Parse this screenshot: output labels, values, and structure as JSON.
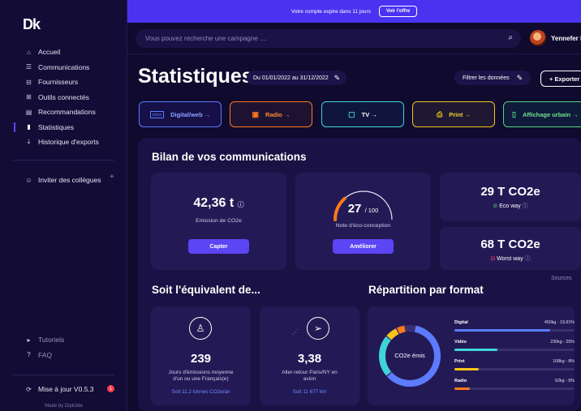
{
  "sidebar": {
    "logo": "Dk",
    "items": [
      {
        "label": "Accueil",
        "icon": "home-icon",
        "glyph": "⌂"
      },
      {
        "label": "Communications",
        "icon": "list-icon",
        "glyph": "☰"
      },
      {
        "label": "Fournisseurs",
        "icon": "factory-icon",
        "glyph": "⊟"
      },
      {
        "label": "Outils connectés",
        "icon": "grid-icon",
        "glyph": "⊞"
      },
      {
        "label": "Recommandations",
        "icon": "document-icon",
        "glyph": "▤"
      },
      {
        "label": "Statistiques",
        "icon": "bar-chart-icon",
        "glyph": "▮"
      },
      {
        "label": "Historique d'exports",
        "icon": "download-icon",
        "glyph": "⤓"
      }
    ],
    "invite": {
      "label": "Inviter des collègues",
      "plus": "+"
    },
    "bottom": [
      {
        "label": "Tutoriels",
        "glyph": "▸"
      },
      {
        "label": "FAQ",
        "glyph": "?"
      }
    ],
    "update": {
      "label": "Mise à jour V0.5.3",
      "badge": "1"
    },
    "made_by": "Made by Diploïde"
  },
  "banner": {
    "text": "Votre compte expire dans 11 jours",
    "button": "Voir l'offre"
  },
  "search": {
    "placeholder": "Vous pouvez recherche une campagne ...."
  },
  "user": {
    "name": "Yennefer D"
  },
  "header": {
    "title": "Statistiques",
    "date_range": "Du 01/01/2022 au 31/12/2022",
    "filter": "Filtrer les données",
    "export": "+ Exporter"
  },
  "formats": [
    {
      "label": "Digital/web →",
      "icon": "monitor-icon",
      "color": "#5b7cff"
    },
    {
      "label": "Radio →",
      "icon": "radio-icon",
      "color": "#ff7a1a"
    },
    {
      "label": "TV →",
      "icon": "tv-icon",
      "color": "#3fd4d8"
    },
    {
      "label": "Print →",
      "icon": "print-icon",
      "color": "#f5c518"
    },
    {
      "label": "Affichage urbain →",
      "icon": "billboard-icon",
      "color": "#4fd67a"
    }
  ],
  "bilan": {
    "title": "Bilan de vos communications",
    "emission": {
      "value": "42,36 t",
      "label": "Emission de CO2e",
      "button": "Capter"
    },
    "note": {
      "value": "27",
      "suffix": "/ 100",
      "score": 27,
      "label": "Note d'éco-conception",
      "button": "Améliorer"
    },
    "eco": {
      "value": "29 T CO2e",
      "label": "Eco way"
    },
    "worst": {
      "value": "68 T CO2e",
      "label": "Worst way"
    },
    "sources": "Sources"
  },
  "equiv": {
    "title": "Soit l'équivalent de...",
    "days": {
      "value": "239",
      "label1": "Jours d'émissions moyenne",
      "label2": "d'un ou une Français(e)",
      "link": "Soit 11,2 tonnes CO2e/an"
    },
    "flight": {
      "value": "3,38",
      "label1": "Aller-retour Paris/NY en",
      "label2": "avion",
      "link": "Soit 11 677 km"
    }
  },
  "repartition": {
    "title": "Répartition par format",
    "center": "CO2e émis",
    "rows": [
      {
        "name": "Digital",
        "value": "450kg - 19,91%",
        "pct": 0.8,
        "color": "#5b7cff"
      },
      {
        "name": "Vidéo",
        "value": "230kg - 25%",
        "pct": 0.36,
        "color": "#3fd4d8"
      },
      {
        "name": "Print",
        "value": "108kg - 8%",
        "pct": 0.2,
        "color": "#f5c518"
      },
      {
        "name": "Radio",
        "value": "62kg - 5%",
        "pct": 0.13,
        "color": "#ff7a1a"
      }
    ]
  }
}
